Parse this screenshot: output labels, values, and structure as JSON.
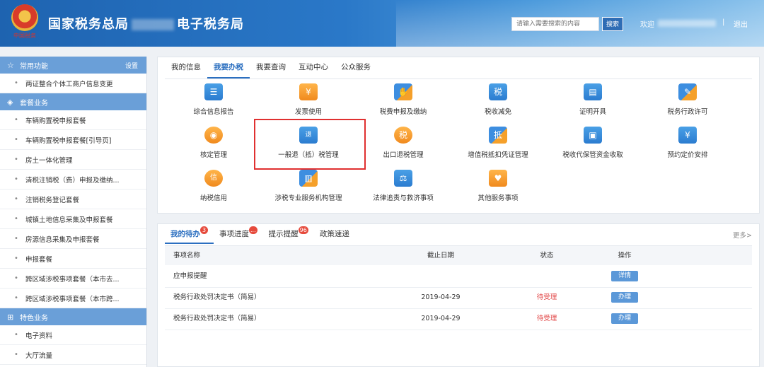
{
  "header": {
    "title_left": "国家税务总局",
    "title_right": "电子税务局",
    "emblem_text": "中国税务",
    "search_placeholder": "请输入需要搜索的内容",
    "search_button": "搜索",
    "welcome": "欢迎",
    "separator": "|",
    "logout": "退出"
  },
  "sidebar": {
    "sections": [
      {
        "title": "常用功能",
        "icon": "star-icon",
        "action": "设置",
        "items": [
          "两证整合个体工商户信息变更"
        ]
      },
      {
        "title": "套餐业务",
        "icon": "layers-icon",
        "items": [
          "车辆购置税申报套餐",
          "车辆购置税申报套餐[引导页]",
          "房土一体化管理",
          "清税注销税（费）申报及缴纳...",
          "注销税务登记套餐",
          "城镇土地信息采集及申报套餐",
          "房源信息采集及申报套餐",
          "申报套餐",
          "跨区域涉税事项套餐（本市去...",
          "跨区域涉税事项套餐（本市跨..."
        ]
      },
      {
        "title": "特色业务",
        "icon": "grid-icon",
        "items": [
          "电子资料",
          "大厅流量"
        ]
      }
    ]
  },
  "main": {
    "tabs": [
      "我的信息",
      "我要办税",
      "我要查询",
      "互动中心",
      "公众服务"
    ],
    "active_tab": 1,
    "services": [
      {
        "label": "综合信息报告",
        "icon": "report-icon",
        "glyph": "☰"
      },
      {
        "label": "发票使用",
        "icon": "invoice-icon",
        "glyph": "¥"
      },
      {
        "label": "税费申报及缴纳",
        "icon": "hand-coin-icon",
        "glyph": "✋"
      },
      {
        "label": "税收减免",
        "icon": "tax-reduction-icon",
        "glyph": "税"
      },
      {
        "label": "证明开具",
        "icon": "certificate-icon",
        "glyph": "▤"
      },
      {
        "label": "税务行政许可",
        "icon": "license-icon",
        "glyph": "✎"
      },
      {
        "label": "核定管理",
        "icon": "person-icon",
        "glyph": "◉"
      },
      {
        "label": "一般退（抵）税管理",
        "icon": "refund-icon",
        "glyph": "退"
      },
      {
        "label": "出口退税管理",
        "icon": "export-refund-icon",
        "glyph": "税"
      },
      {
        "label": "增值税抵扣凭证管理",
        "icon": "deduction-voucher-icon",
        "glyph": "抵"
      },
      {
        "label": "税收代保管资金收取",
        "icon": "fund-custody-icon",
        "glyph": "▣"
      },
      {
        "label": "预约定价安排",
        "icon": "calendar-icon",
        "glyph": "¥"
      },
      {
        "label": "纳税信用",
        "icon": "credit-icon",
        "glyph": "信"
      },
      {
        "label": "涉税专业服务机构管理",
        "icon": "agency-icon",
        "glyph": "▥"
      },
      {
        "label": "法律追责与救济事项",
        "icon": "gavel-icon",
        "glyph": "⚖"
      },
      {
        "label": "其他服务事项",
        "icon": "heart-hands-icon",
        "glyph": "♥"
      }
    ]
  },
  "todo": {
    "tabs": [
      {
        "label": "我的待办",
        "badge": "3"
      },
      {
        "label": "事项进度",
        "badge": "..."
      },
      {
        "label": "提示提醒",
        "badge": "96"
      },
      {
        "label": "政策速递",
        "badge": ""
      }
    ],
    "more": "更多>",
    "columns": [
      "事项名称",
      "截止日期",
      "状态",
      "操作"
    ],
    "rows": [
      {
        "name": "应申报提醒",
        "date": "",
        "status": "",
        "action": "详情"
      },
      {
        "name": "税务行政处罚决定书（简易）",
        "date": "2019-04-29",
        "status": "待受理",
        "action": "办理"
      },
      {
        "name": "税务行政处罚决定书（简易）",
        "date": "2019-04-29",
        "status": "待受理",
        "action": "办理"
      }
    ],
    "colors": {
      "status": "#e04040",
      "accent": "#2b6fc0"
    }
  }
}
